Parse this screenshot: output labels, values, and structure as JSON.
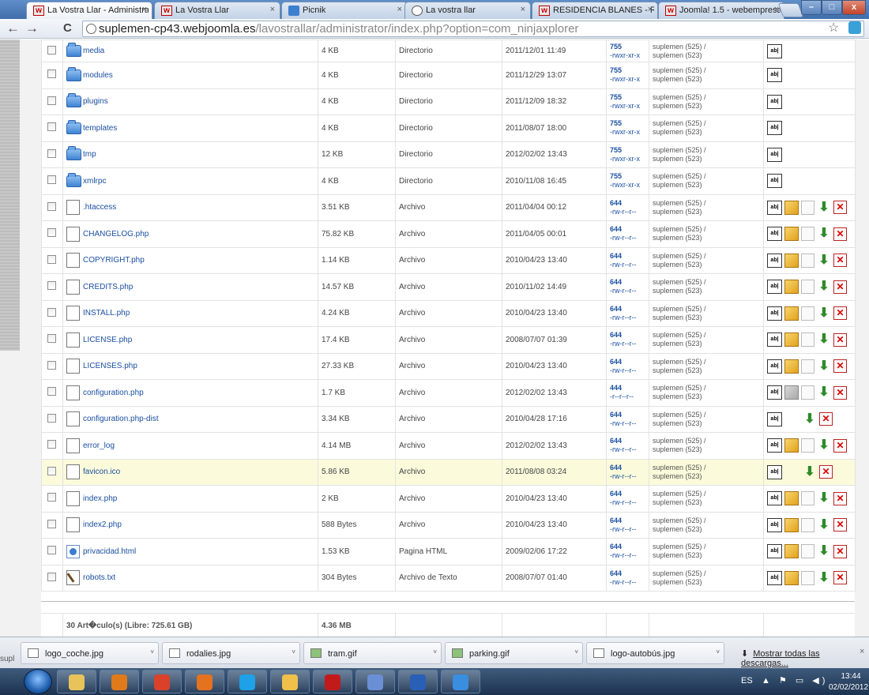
{
  "browser": {
    "tabs": [
      {
        "label": "La Vostra Llar - Administra",
        "favicon": "w",
        "active": true
      },
      {
        "label": "La Vostra Llar",
        "favicon": "w",
        "active": false
      },
      {
        "label": "Picnik",
        "favicon": "picnik",
        "active": false
      },
      {
        "label": "La vostra llar",
        "favicon": "globe",
        "active": false
      },
      {
        "label": "RESIDENCIA BLANES - Res",
        "favicon": "w",
        "active": false
      },
      {
        "label": "Joomla! 1.5 - webempresa",
        "favicon": "w",
        "active": false
      }
    ],
    "tab_close": "×",
    "url_host": "suplemen-cp43.webjoomla.es",
    "url_path": "/lavostrallar/administrator/index.php?option=com_ninjaxplorer",
    "back": "←",
    "forward": "→",
    "reload": "C",
    "star": "☆",
    "min": "–",
    "max": "□",
    "close": "x"
  },
  "files": [
    {
      "name": "media",
      "size": "4 KB",
      "type": "Directorio",
      "modified": "2011/12/01 11:49",
      "perm": "755",
      "perm_str": "-rwxr-xr-x",
      "owner": "suplemen (525) /",
      "group": "suplemen (523)",
      "kind": "folder"
    },
    {
      "name": "modules",
      "size": "4 KB",
      "type": "Directorio",
      "modified": "2011/12/29 13:07",
      "perm": "755",
      "perm_str": "-rwxr-xr-x",
      "owner": "suplemen (525) /",
      "group": "suplemen (523)",
      "kind": "folder"
    },
    {
      "name": "plugins",
      "size": "4 KB",
      "type": "Directorio",
      "modified": "2011/12/09 18:32",
      "perm": "755",
      "perm_str": "-rwxr-xr-x",
      "owner": "suplemen (525) /",
      "group": "suplemen (523)",
      "kind": "folder"
    },
    {
      "name": "templates",
      "size": "4 KB",
      "type": "Directorio",
      "modified": "2011/08/07 18:00",
      "perm": "755",
      "perm_str": "-rwxr-xr-x",
      "owner": "suplemen (525) /",
      "group": "suplemen (523)",
      "kind": "folder"
    },
    {
      "name": "tmp",
      "size": "12 KB",
      "type": "Directorio",
      "modified": "2012/02/02 13:43",
      "perm": "755",
      "perm_str": "-rwxr-xr-x",
      "owner": "suplemen (525) /",
      "group": "suplemen (523)",
      "kind": "folder"
    },
    {
      "name": "xmlrpc",
      "size": "4 KB",
      "type": "Directorio",
      "modified": "2010/11/08 16:45",
      "perm": "755",
      "perm_str": "-rwxr-xr-x",
      "owner": "suplemen (525) /",
      "group": "suplemen (523)",
      "kind": "folder"
    },
    {
      "name": ".htaccess",
      "size": "3.51 KB",
      "type": "Archivo",
      "modified": "2011/04/04 00:12",
      "perm": "644",
      "perm_str": "-rw-r--r--",
      "owner": "suplemen (525) /",
      "group": "suplemen (523)",
      "kind": "file"
    },
    {
      "name": "CHANGELOG.php",
      "size": "75.82 KB",
      "type": "Archivo",
      "modified": "2011/04/05 00:01",
      "perm": "644",
      "perm_str": "-rw-r--r--",
      "owner": "suplemen (525) /",
      "group": "suplemen (523)",
      "kind": "file"
    },
    {
      "name": "COPYRIGHT.php",
      "size": "1.14 KB",
      "type": "Archivo",
      "modified": "2010/04/23 13:40",
      "perm": "644",
      "perm_str": "-rw-r--r--",
      "owner": "suplemen (525) /",
      "group": "suplemen (523)",
      "kind": "file"
    },
    {
      "name": "CREDITS.php",
      "size": "14.57 KB",
      "type": "Archivo",
      "modified": "2010/11/02 14:49",
      "perm": "644",
      "perm_str": "-rw-r--r--",
      "owner": "suplemen (525) /",
      "group": "suplemen (523)",
      "kind": "file"
    },
    {
      "name": "INSTALL.php",
      "size": "4.24 KB",
      "type": "Archivo",
      "modified": "2010/04/23 13:40",
      "perm": "644",
      "perm_str": "-rw-r--r--",
      "owner": "suplemen (525) /",
      "group": "suplemen (523)",
      "kind": "file"
    },
    {
      "name": "LICENSE.php",
      "size": "17.4 KB",
      "type": "Archivo",
      "modified": "2008/07/07 01:39",
      "perm": "644",
      "perm_str": "-rw-r--r--",
      "owner": "suplemen (525) /",
      "group": "suplemen (523)",
      "kind": "file"
    },
    {
      "name": "LICENSES.php",
      "size": "27.33 KB",
      "type": "Archivo",
      "modified": "2010/04/23 13:40",
      "perm": "644",
      "perm_str": "-rw-r--r--",
      "owner": "suplemen (525) /",
      "group": "suplemen (523)",
      "kind": "file"
    },
    {
      "name": "configuration.php",
      "size": "1.7 KB",
      "type": "Archivo",
      "modified": "2012/02/02 13:43",
      "perm": "444",
      "perm_str": "-r--r--r--",
      "owner": "suplemen (525) /",
      "group": "suplemen (523)",
      "kind": "file",
      "edit_disabled": true
    },
    {
      "name": "configuration.php-dist",
      "size": "3.34 KB",
      "type": "Archivo",
      "modified": "2010/04/28 17:16",
      "perm": "644",
      "perm_str": "-rw-r--r--",
      "owner": "suplemen (525) /",
      "group": "suplemen (523)",
      "kind": "file",
      "no_edit": true
    },
    {
      "name": "error_log",
      "size": "4.14 MB",
      "type": "Archivo",
      "modified": "2012/02/02 13:43",
      "perm": "644",
      "perm_str": "-rw-r--r--",
      "owner": "suplemen (525) /",
      "group": "suplemen (523)",
      "kind": "file"
    },
    {
      "name": "favicon.ico",
      "size": "5.86 KB",
      "type": "Archivo",
      "modified": "2011/08/08 03:24",
      "perm": "644",
      "perm_str": "-rw-r--r--",
      "owner": "suplemen (525) /",
      "group": "suplemen (523)",
      "kind": "file",
      "no_edit": true,
      "highlighted": true
    },
    {
      "name": "index.php",
      "size": "2 KB",
      "type": "Archivo",
      "modified": "2010/04/23 13:40",
      "perm": "644",
      "perm_str": "-rw-r--r--",
      "owner": "suplemen (525) /",
      "group": "suplemen (523)",
      "kind": "file"
    },
    {
      "name": "index2.php",
      "size": "588 Bytes",
      "type": "Archivo",
      "modified": "2010/04/23 13:40",
      "perm": "644",
      "perm_str": "-rw-r--r--",
      "owner": "suplemen (525) /",
      "group": "suplemen (523)",
      "kind": "file"
    },
    {
      "name": "privacidad.html",
      "size": "1.53 KB",
      "type": "Pagina HTML",
      "modified": "2009/02/06 17:22",
      "perm": "644",
      "perm_str": "-rw-r--r--",
      "owner": "suplemen (525) /",
      "group": "suplemen (523)",
      "kind": "html"
    },
    {
      "name": "robots.txt",
      "size": "304 Bytes",
      "type": "Archivo de Texto",
      "modified": "2008/07/07 01:40",
      "perm": "644",
      "perm_str": "-rw-r--r--",
      "owner": "suplemen (525) /",
      "group": "suplemen (523)",
      "kind": "txt"
    }
  ],
  "rename_icon_text": "ab|",
  "footer": {
    "items_text": "30 Art�culo(s) (Libre: 725.61 GB)",
    "total_size": "4.36 MB"
  },
  "downloads": {
    "status_text": "supl",
    "items": [
      {
        "name": "logo_coche.jpg",
        "icon": "image-file-icon"
      },
      {
        "name": "rodalies.jpg",
        "icon": "image-file-icon"
      },
      {
        "name": "tram.gif",
        "icon": "gif-file-icon"
      },
      {
        "name": "parking.gif",
        "icon": "gif-file-icon"
      },
      {
        "name": "logo-autobús.jpg",
        "icon": "image-file-icon"
      }
    ],
    "arrow": "˅",
    "show_all": "Mostrar todas las descargas...",
    "close": "×"
  },
  "taskbar": {
    "lang": "ES",
    "time": "13:44",
    "date": "02/02/2012",
    "tray_icons": "▲ ⚑ ▭ ◀)",
    "apps": [
      {
        "name": "explorer",
        "color": "#e8c35a"
      },
      {
        "name": "media-player",
        "color": "#e07a1a"
      },
      {
        "name": "chrome",
        "color": "#d9412b"
      },
      {
        "name": "firefox",
        "color": "#e4721f"
      },
      {
        "name": "skype",
        "color": "#1ea1e6"
      },
      {
        "name": "mail",
        "color": "#f0c04a"
      },
      {
        "name": "filezilla",
        "color": "#c21a1a"
      },
      {
        "name": "paint",
        "color": "#6b8fd4"
      },
      {
        "name": "word",
        "color": "#2a5fb8"
      },
      {
        "name": "ie",
        "color": "#3a8ee0"
      }
    ]
  }
}
